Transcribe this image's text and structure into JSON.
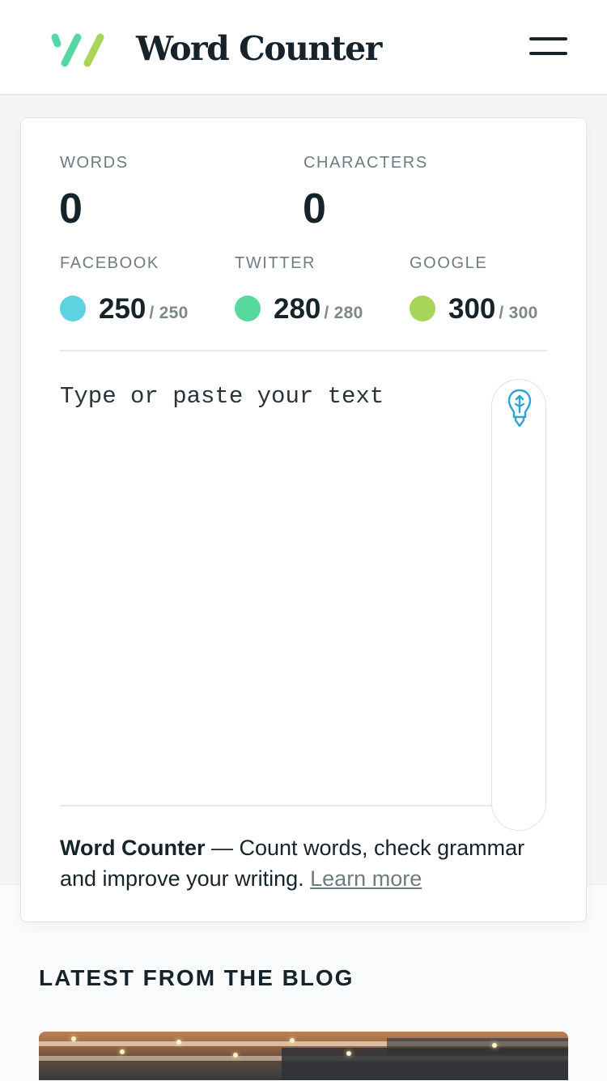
{
  "header": {
    "brand": "Word Counter",
    "logo_icon": "word-counter-logo-icon",
    "menu_icon": "hamburger-menu-icon",
    "logo_colors": [
      "#58d6a5",
      "#a9d65a"
    ]
  },
  "counters": {
    "words_label": "WORDS",
    "words_value": "0",
    "characters_label": "CHARACTERS",
    "characters_value": "0"
  },
  "limits": [
    {
      "label": "FACEBOOK",
      "remaining": "250",
      "max": "/ 250",
      "color": "#5dd3e2"
    },
    {
      "label": "TWITTER",
      "remaining": "280",
      "max": "/ 280",
      "color": "#58d99c"
    },
    {
      "label": "GOOGLE",
      "remaining": "300",
      "max": "/ 300",
      "color": "#a8d45a"
    }
  ],
  "editor": {
    "placeholder": "Type or paste your text",
    "value": "",
    "assist_icon": "lightbulb-pen-icon",
    "assist_icon_color": "#2ea3d6"
  },
  "footer": {
    "brand": "Word Counter",
    "tagline": " — Count words, check grammar and improve your writing. ",
    "link": "Learn more"
  },
  "blog": {
    "heading": "LATEST FROM THE BLOG"
  }
}
